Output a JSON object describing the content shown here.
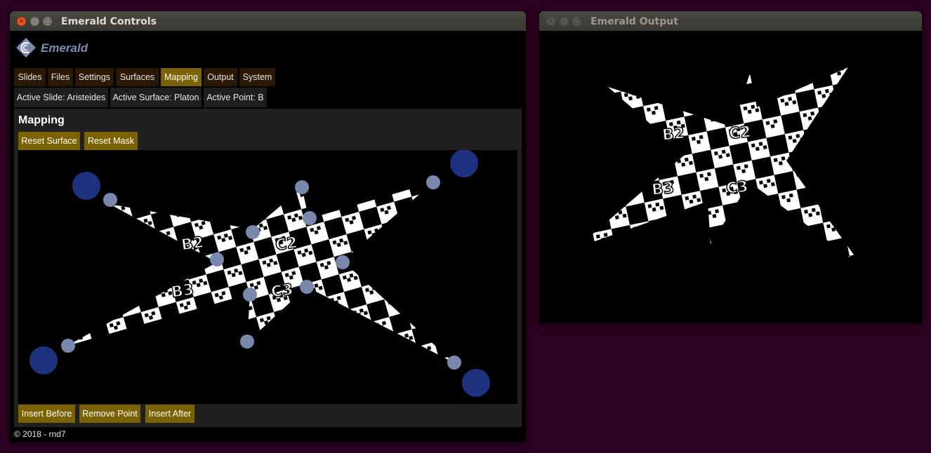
{
  "controls_window": {
    "title": "Emerald Controls",
    "logo_text": "Emerald",
    "tabs": [
      {
        "label": "Slides",
        "active": false
      },
      {
        "label": "Files",
        "active": false
      },
      {
        "label": "Settings",
        "active": false
      },
      {
        "label": "Surfaces",
        "active": false
      },
      {
        "label": "Mapping",
        "active": true
      },
      {
        "label": "Output",
        "active": false
      },
      {
        "label": "System",
        "active": false
      }
    ],
    "status": {
      "active_slide": "Active Slide: Aristeides",
      "active_surface": "Active Surface: Platon",
      "active_point": "Active Point: B"
    },
    "mapping": {
      "heading": "Mapping",
      "reset_surface": "Reset Surface",
      "reset_mask": "Reset Mask",
      "insert_before": "Insert Before",
      "remove_point": "Remove Point",
      "insert_after": "Insert After",
      "texture_labels": [
        "B2",
        "C2",
        "B3",
        "C3"
      ]
    },
    "footer": "© 2018 - rnd7"
  },
  "output_window": {
    "title": "Emerald Output",
    "texture_labels": [
      "B2",
      "C2",
      "B3",
      "C3"
    ]
  },
  "colors": {
    "desktop": "#2c0122",
    "accent": "#7a6200",
    "tab_bg": "#2a1800",
    "corner_handle": "#1f3280",
    "point_handle": "#7b88ad"
  }
}
